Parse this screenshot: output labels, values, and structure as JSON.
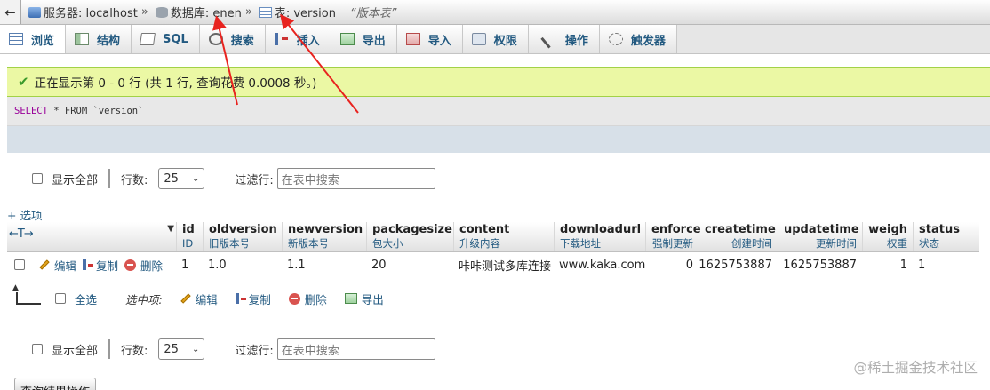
{
  "breadcrumb": {
    "back": "←",
    "server": "服务器: localhost",
    "database": "数据库: enen",
    "table": "表: version",
    "separator": "»",
    "comment": "“版本表”"
  },
  "tabs": [
    {
      "label": "浏览",
      "icon": "browse-icon",
      "active": true
    },
    {
      "label": "结构",
      "icon": "structure-icon"
    },
    {
      "label": "SQL",
      "icon": "sql-icon"
    },
    {
      "label": "搜索",
      "icon": "search-icon"
    },
    {
      "label": "插入",
      "icon": "insert-icon"
    },
    {
      "label": "导出",
      "icon": "export-icon"
    },
    {
      "label": "导入",
      "icon": "import-icon"
    },
    {
      "label": "权限",
      "icon": "privileges-icon"
    },
    {
      "label": "操作",
      "icon": "operations-icon"
    },
    {
      "label": "触发器",
      "icon": "triggers-icon"
    }
  ],
  "message": {
    "icon": "check-icon",
    "text": "正在显示第 0 - 0 行 (共 1 行, 查询花费 0.0008 秒。)"
  },
  "query": {
    "select": "SELECT",
    "rest": " * FROM `version`"
  },
  "nav": {
    "show_all": "显示全部",
    "rows_label": "行数:",
    "rows_value": "25",
    "filter_label": "过滤行:",
    "filter_placeholder": "在表中搜索"
  },
  "options_link": "+ 选项",
  "table": {
    "columns": [
      {
        "name": "id",
        "comment": "ID"
      },
      {
        "name": "oldversion",
        "comment": "旧版本号"
      },
      {
        "name": "newversion",
        "comment": "新版本号"
      },
      {
        "name": "packagesize",
        "comment": "包大小"
      },
      {
        "name": "content",
        "comment": "升级内容"
      },
      {
        "name": "downloadurl",
        "comment": "下载地址"
      },
      {
        "name": "enforce",
        "comment": "强制更新"
      },
      {
        "name": "createtime",
        "comment": "创建时间"
      },
      {
        "name": "updatetime",
        "comment": "更新时间"
      },
      {
        "name": "weigh",
        "comment": "权重"
      },
      {
        "name": "status",
        "comment": "状态"
      }
    ],
    "row_actions": {
      "edit": "编辑",
      "copy": "复制",
      "delete": "删除"
    },
    "rows": [
      [
        "1",
        "1.0",
        "1.1",
        "20",
        "咔咔测试多库连接",
        "www.kaka.com",
        "0",
        "1625753887",
        "1625753887",
        "1",
        "1"
      ]
    ]
  },
  "bulk": {
    "select_all": "全选",
    "with_selected": "选中项:",
    "edit": "编辑",
    "copy": "复制",
    "delete": "删除",
    "export": "导出"
  },
  "query_ops_button": "查询结果操作",
  "watermark": "@稀土掘金技术社区",
  "colors": {
    "annotation_arrow": "#e8231f",
    "link": "#235a81",
    "success_bg": "#ebf8a4"
  }
}
